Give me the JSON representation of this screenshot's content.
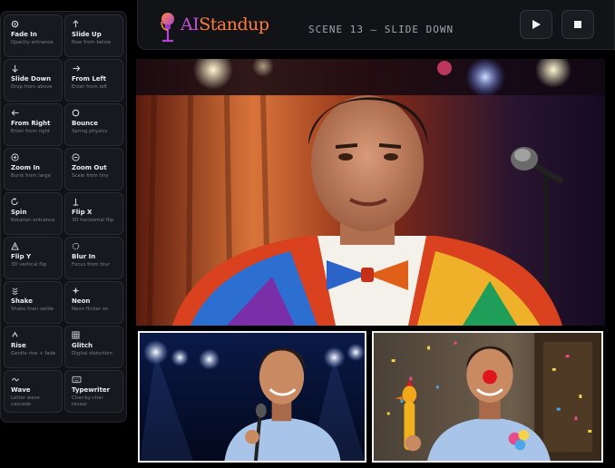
{
  "sidebar": {
    "effects": [
      {
        "icon": "circle-icon",
        "name": "Fade In",
        "desc": "Opacity entrance"
      },
      {
        "icon": "arrow-up-icon",
        "name": "Slide Up",
        "desc": "Rise from below"
      },
      {
        "icon": "arrow-down-icon",
        "name": "Slide Down",
        "desc": "Drop from above"
      },
      {
        "icon": "arrow-right-icon",
        "name": "From Left",
        "desc": "Enter from left"
      },
      {
        "icon": "arrow-left-icon",
        "name": "From Right",
        "desc": "Enter from right"
      },
      {
        "icon": "ring-icon",
        "name": "Bounce",
        "desc": "Spring physics"
      },
      {
        "icon": "zoom-in-icon",
        "name": "Zoom In",
        "desc": "Burst from large"
      },
      {
        "icon": "zoom-out-icon",
        "name": "Zoom Out",
        "desc": "Scale from tiny"
      },
      {
        "icon": "rotate-icon",
        "name": "Spin",
        "desc": "Rotation entrance"
      },
      {
        "icon": "flip-x-icon",
        "name": "Flip X",
        "desc": "3D horizontal flip"
      },
      {
        "icon": "warning-icon",
        "name": "Flip Y",
        "desc": "3D vertical flip"
      },
      {
        "icon": "blur-icon",
        "name": "Blur In",
        "desc": "Focus from blur"
      },
      {
        "icon": "shake-icon",
        "name": "Shake",
        "desc": "Shake then settle"
      },
      {
        "icon": "sparkle-icon",
        "name": "Neon",
        "desc": "Neon flicker on"
      },
      {
        "icon": "caret-up-icon",
        "name": "Rise",
        "desc": "Gentle rise + fade"
      },
      {
        "icon": "glitch-icon",
        "name": "Glitch",
        "desc": "Digital distortion"
      },
      {
        "icon": "wave-icon",
        "name": "Wave",
        "desc": "Letter wave cascade"
      },
      {
        "icon": "keyboard-icon",
        "name": "Typewriter",
        "desc": "Char-by-char reveal"
      }
    ]
  },
  "header": {
    "brand_prefix": "AI",
    "brand_suffix": "Standup",
    "scene_label": "SCENE 13 — SLIDE DOWN"
  },
  "colors": {
    "brand_purple": "#c04fd6",
    "brand_orange": "#ff7a3d",
    "panel_bg": "#111216"
  }
}
